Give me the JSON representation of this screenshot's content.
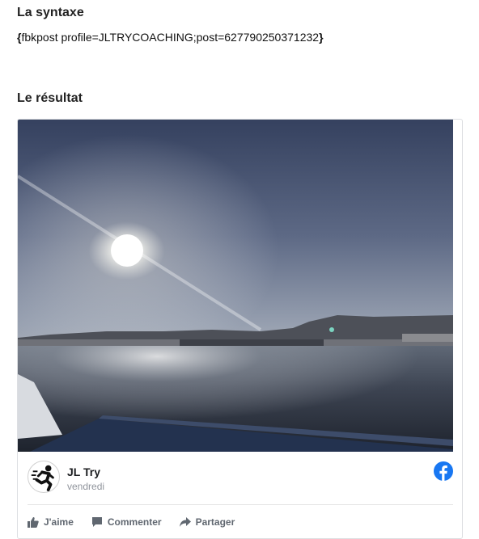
{
  "syntax_section": {
    "heading": "La syntaxe",
    "brace_open": "{",
    "code": "fbkpost profile=JLTRYCOACHING;post=627790250371232",
    "brace_close": "}"
  },
  "result_section": {
    "heading": "Le résultat"
  },
  "facebook_post": {
    "author": "JL  Try",
    "date": "vendredi",
    "avatar_icon": "runner-icon",
    "brand_icon": "facebook-logo-icon",
    "brand_color": "#1877f2",
    "actions": [
      {
        "label": "J'aime",
        "icon": "thumbs-up-icon"
      },
      {
        "label": "Commenter",
        "icon": "comment-icon"
      },
      {
        "label": "Partager",
        "icon": "share-icon"
      }
    ]
  }
}
